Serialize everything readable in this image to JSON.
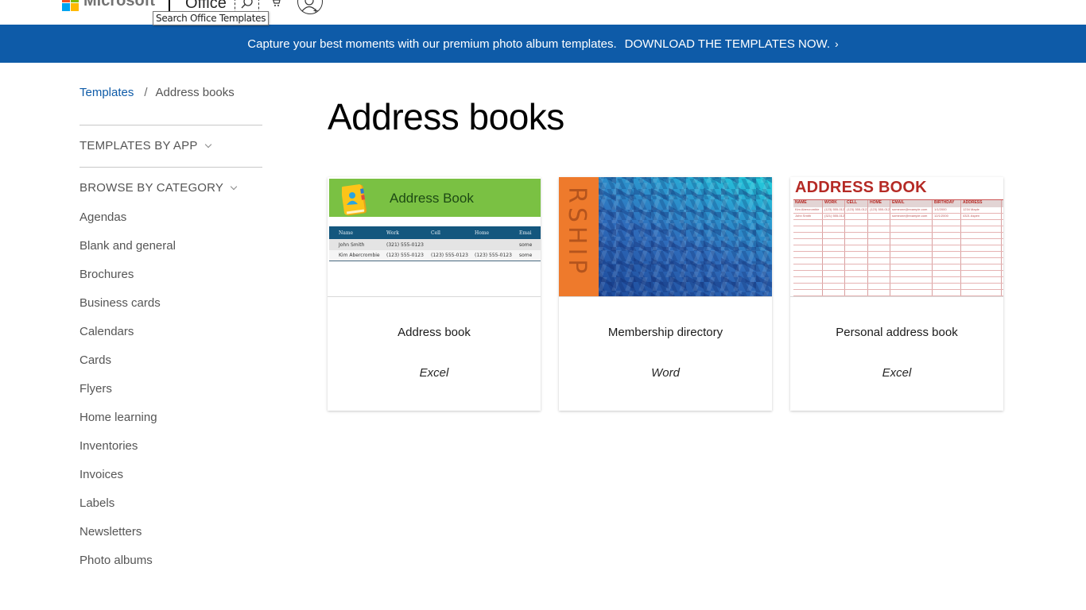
{
  "header": {
    "brand": "Microsoft",
    "brand_colors": [
      "#f25022",
      "#7fba00",
      "#00a4ef",
      "#ffb900"
    ],
    "product": "Office",
    "search_tooltip": "Search Office Templates",
    "icons": {
      "search": "search-icon",
      "cart": "cart-icon",
      "profile": "add-profile-icon"
    }
  },
  "banner": {
    "message": "Capture your best moments with our premium photo album templates.",
    "cta": "DOWNLOAD THE TEMPLATES NOW.",
    "cta_icon": "›",
    "background": "#0e5ba8"
  },
  "breadcrumb": {
    "root": "Templates",
    "separator": "/",
    "current": "Address books"
  },
  "sidebar": {
    "templates_by_app": "TEMPLATES BY APP",
    "browse_by_category": "BROWSE BY CATEGORY",
    "categories": [
      "Agendas",
      "Blank and general",
      "Brochures",
      "Business cards",
      "Calendars",
      "Cards",
      "Flyers",
      "Home learning",
      "Inventories",
      "Invoices",
      "Labels",
      "Newsletters",
      "Photo albums"
    ]
  },
  "main": {
    "title": "Address books",
    "templates": [
      {
        "name": "Address book",
        "app": "Excel",
        "preview": {
          "title": "Address Book",
          "columns": [
            "Name",
            "Work",
            "Cell",
            "Home",
            "Emai"
          ],
          "rows": [
            [
              "John Smith",
              "(321) 555-0123",
              "",
              "",
              "some"
            ],
            [
              "Kim Abercrombie",
              "(123) 555-0123",
              "(123) 555-0123",
              "(123) 555-0123",
              "some"
            ]
          ]
        }
      },
      {
        "name": "Membership directory",
        "app": "Word",
        "preview": {
          "side_text": "RSHIP"
        }
      },
      {
        "name": "Personal address book",
        "app": "Excel",
        "preview": {
          "title": "ADDRESS BOOK",
          "columns": [
            "NAME",
            "WORK",
            "CELL",
            "HOME",
            "EMAIL",
            "BIRTHDAY",
            "ADDRESS"
          ],
          "rows": [
            [
              "Kim Abercrombie",
              "(123) 555-0123",
              "(123) 555-0123",
              "(123) 555-0123",
              "someone@example.com",
              "1/1/2000",
              "1234 Maple"
            ],
            [
              "John Smith",
              "(321) 555-0123",
              "",
              "",
              "someone@example.com",
              "12/1/2000",
              "4321 Aspen"
            ]
          ]
        }
      }
    ]
  }
}
